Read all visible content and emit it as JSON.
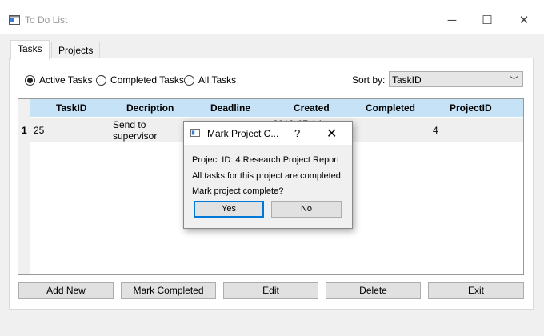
{
  "window": {
    "title": "To Do List",
    "controls": {
      "minimize": "─",
      "maximize": "☐",
      "close": "✕"
    }
  },
  "tabs": [
    {
      "label": "Tasks",
      "active": true
    },
    {
      "label": "Projects",
      "active": false
    }
  ],
  "filters": {
    "options": [
      {
        "label": "Active Tasks",
        "selected": true
      },
      {
        "label": "Completed Tasks",
        "selected": false
      },
      {
        "label": "All Tasks",
        "selected": false
      }
    ]
  },
  "sort": {
    "label": "Sort by:",
    "value": "TaskID",
    "chevron": "﹀"
  },
  "table": {
    "columns": [
      "TaskID",
      "Decription",
      "Deadline",
      "Created",
      "Completed",
      "ProjectID"
    ],
    "rows": [
      {
        "row_number": "1",
        "task_id": "25",
        "description_line1": "Send to",
        "description_line2": "supervisor",
        "created_partial": "2019-07-14",
        "project_id": "4"
      }
    ]
  },
  "buttons": {
    "add_new": "Add New",
    "mark_completed": "Mark Completed",
    "edit": "Edit",
    "delete": "Delete",
    "exit": "Exit"
  },
  "dialog": {
    "title": "Mark Project C...",
    "help": "?",
    "close": "✕",
    "project_line": "Project ID: 4   Research Project Report",
    "message": "All tasks for this project are completed.",
    "question": "Mark project complete?",
    "yes": "Yes",
    "no": "No"
  },
  "colors": {
    "header_bg": "#c6e2f7",
    "accent": "#0078d7"
  }
}
